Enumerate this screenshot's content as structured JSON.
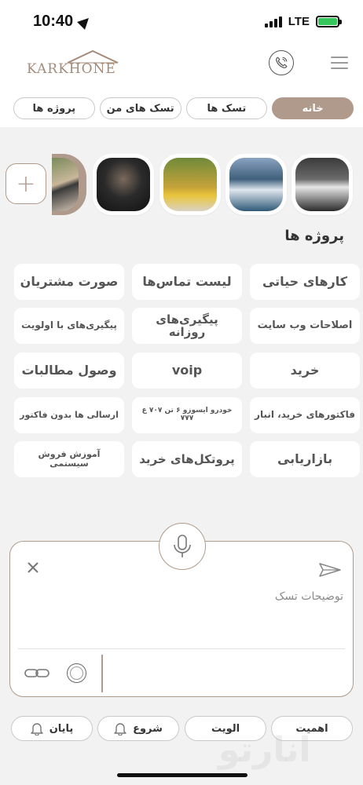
{
  "status_bar": {
    "time": "10:40",
    "network": "LTE"
  },
  "app": {
    "logo_text": "KARKHONE"
  },
  "tabs": [
    {
      "label": "خانه",
      "active": true
    },
    {
      "label": "تسک ها",
      "active": false
    },
    {
      "label": "تسک های من",
      "active": false
    },
    {
      "label": "پروژه ها",
      "active": false
    }
  ],
  "stories": {
    "add_symbol": "+",
    "items": [
      {
        "name": "story-1"
      },
      {
        "name": "story-2"
      },
      {
        "name": "story-3"
      },
      {
        "name": "story-4"
      },
      {
        "name": "story-5"
      }
    ]
  },
  "projects": {
    "title": "پروژه ها",
    "items": [
      "کارهای حیاتی",
      "لیست تماس‌ها",
      "صورت مشتریان",
      "اصلاحات وب سایت",
      "پیگیری‌های روزانه",
      "پیگیری‌های با اولویت",
      "خرید",
      "voip",
      "وصول مطالبات",
      "فاکتورهای خرید، انبار",
      "خودرو ایسوزو ۶ تن ۷۰۷ ع ۷۷۷",
      "ارسالی ها بدون فاکتور",
      "بازاریابی",
      "پروتکل‌های خرید",
      "آموزش فروش سیستمی"
    ]
  },
  "composer": {
    "placeholder": "توضیحات تسک"
  },
  "bottom_chips": [
    {
      "label": "اهمیت",
      "bell": false
    },
    {
      "label": "الویت",
      "bell": false
    },
    {
      "label": "شروع",
      "bell": true
    },
    {
      "label": "پایان",
      "bell": true
    }
  ],
  "watermark": "انارتو",
  "colors": {
    "accent": "#b09a8b",
    "background": "#f2f2f3",
    "battery": "#35c759"
  }
}
